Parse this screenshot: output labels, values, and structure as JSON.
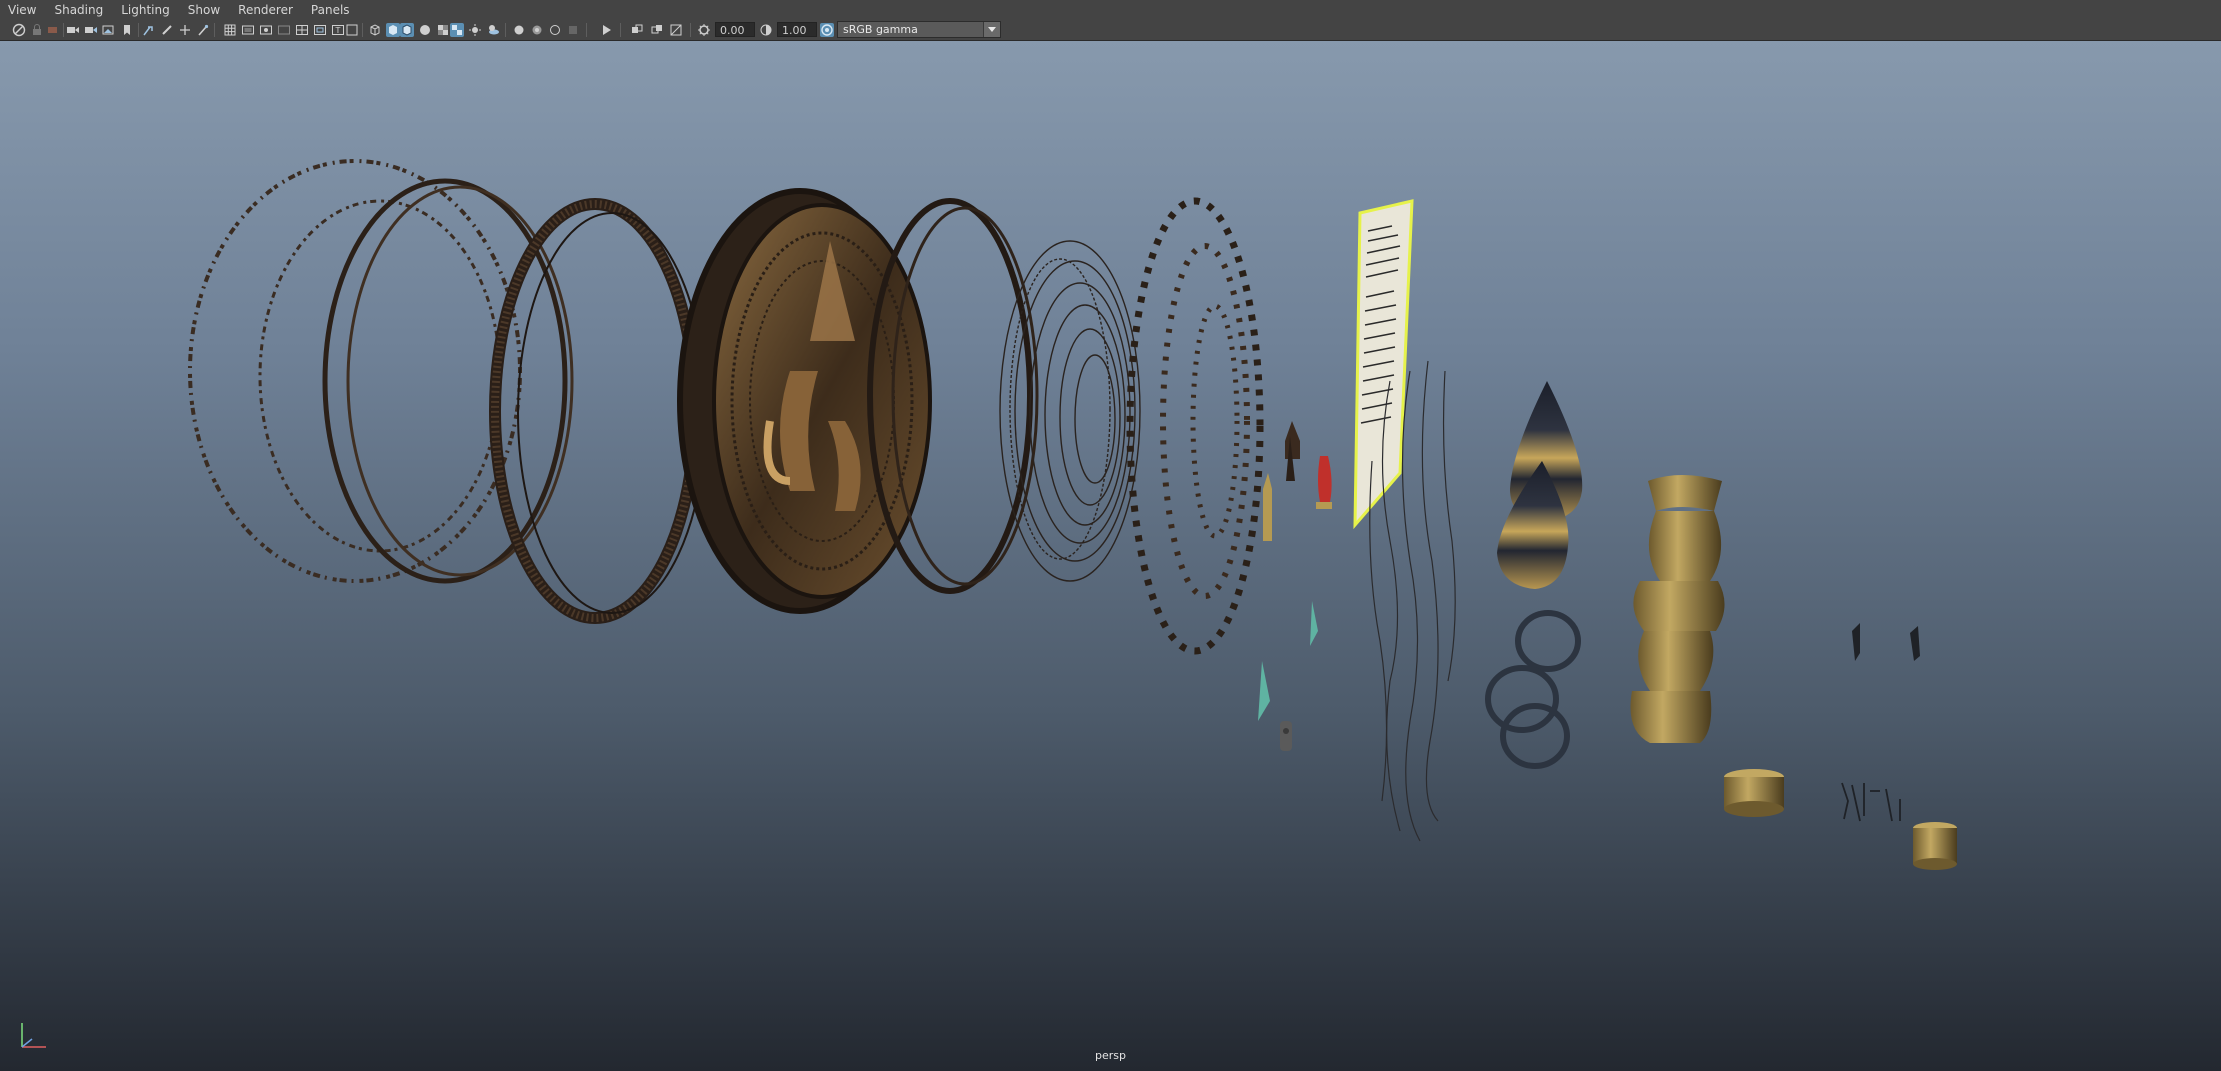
{
  "menubar": {
    "items": [
      {
        "id": "view",
        "label": "View"
      },
      {
        "id": "shading",
        "label": "Shading"
      },
      {
        "id": "lighting",
        "label": "Lighting"
      },
      {
        "id": "show",
        "label": "Show"
      },
      {
        "id": "renderer",
        "label": "Renderer"
      },
      {
        "id": "panels",
        "label": "Panels"
      }
    ]
  },
  "toolbar": {
    "exposure_value": "0.00",
    "gamma_value": "1.00",
    "color_space": "sRGB gamma",
    "icons": [
      "select-camera-icon",
      "lock-camera-icon",
      "camera-attributes-icon",
      "bookmark-icon",
      "image-plane-icon",
      "grid-icon",
      "film-gate-icon",
      "resolution-gate-icon",
      "gate-mask-icon",
      "field-chart-icon",
      "safe-action-icon",
      "safe-title-icon",
      "wireframe-icon",
      "smooth-shade-icon",
      "default-lighting-icon",
      "shadows-icon",
      "textured-icon",
      "isolate-select-icon",
      "xray-icon",
      "ambient-occlusion-icon",
      "motion-blur-icon",
      "anti-aliasing-icon",
      "depth-of-field-icon",
      "exposure-icon",
      "gamma-icon",
      "color-management-icon"
    ]
  },
  "viewport": {
    "camera": "persp",
    "background_top": "#8799ad",
    "background_bottom": "#232830",
    "selection_color": "#e6f24a",
    "material_bronze": "#7a5a32",
    "material_gold": "#b59a52"
  }
}
